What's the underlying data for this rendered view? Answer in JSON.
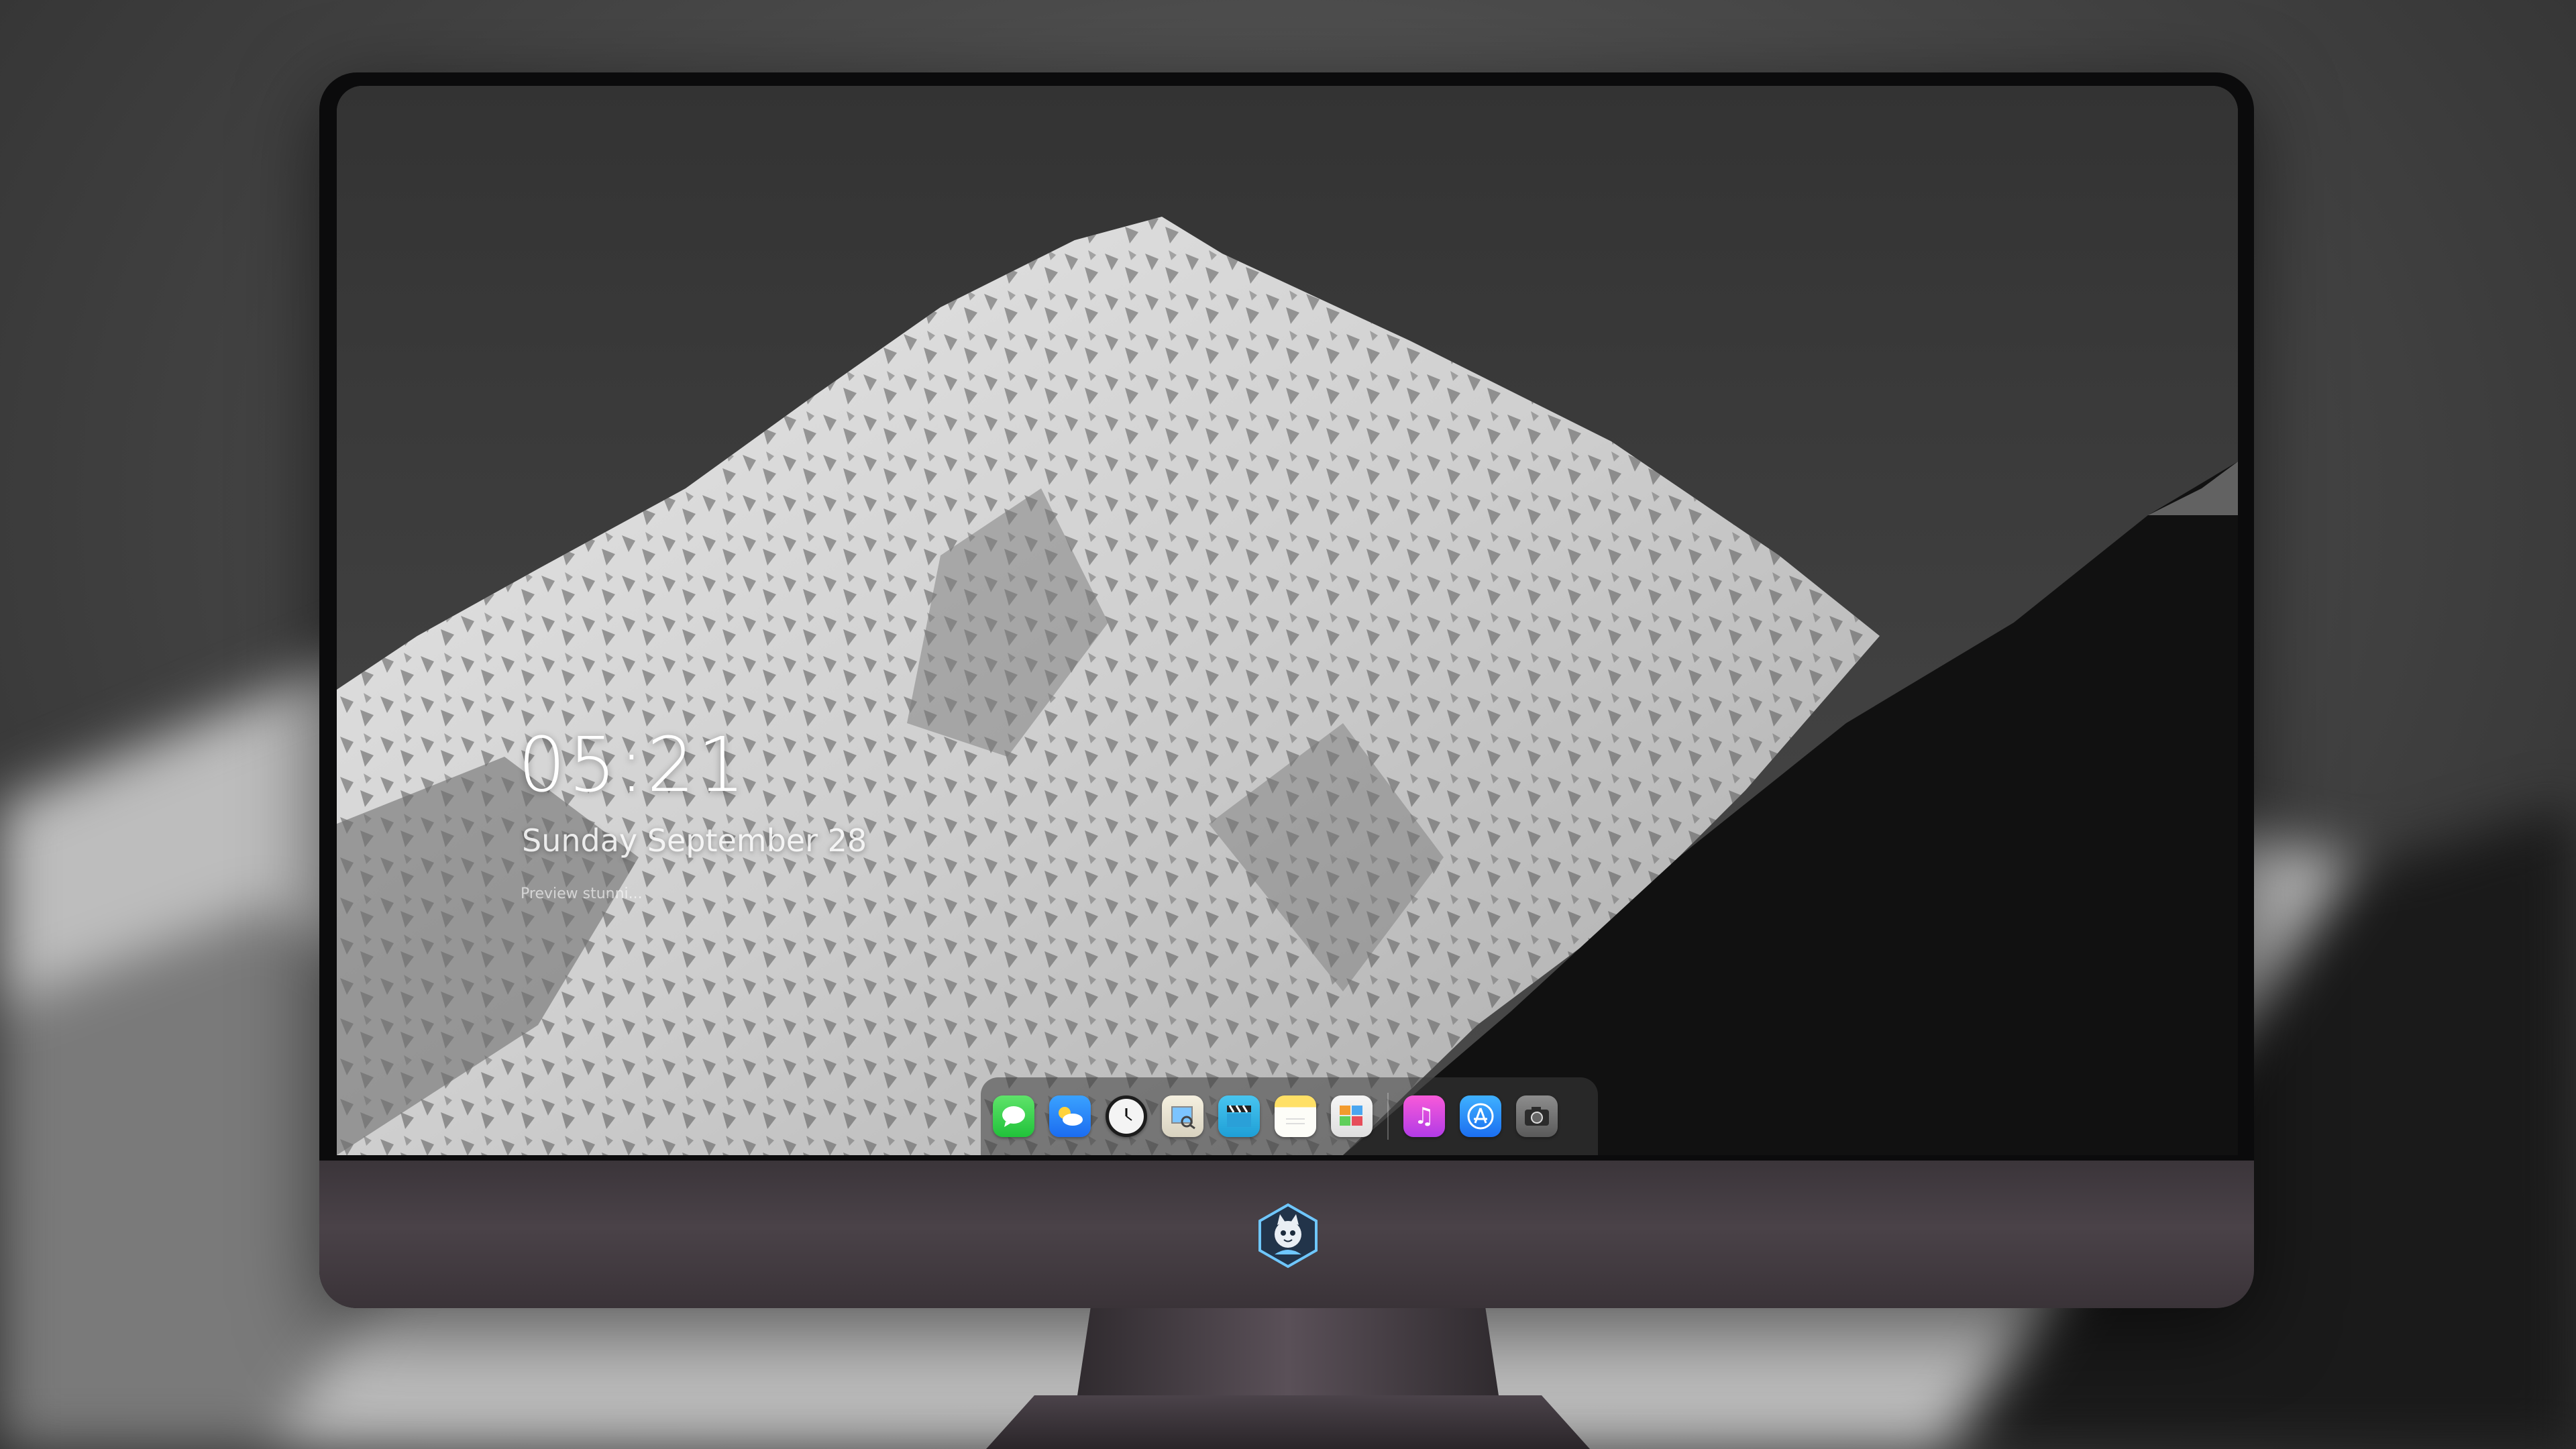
{
  "lockscreen": {
    "time": "05:21",
    "date": "Sunday September 28",
    "caption": "Preview stunni..."
  },
  "dock": {
    "apps": [
      {
        "name": "messages",
        "icon": "messages-icon"
      },
      {
        "name": "weather",
        "icon": "weather-icon"
      },
      {
        "name": "clock",
        "icon": "clock-icon"
      },
      {
        "name": "preview",
        "icon": "preview-icon"
      },
      {
        "name": "clips",
        "icon": "clapperboard-icon"
      },
      {
        "name": "notes",
        "icon": "notes-icon"
      },
      {
        "name": "photos",
        "icon": "photo-booth-icon"
      },
      {
        "name": "music",
        "icon": "music-note-icon"
      },
      {
        "name": "app-store",
        "icon": "app-store-icon"
      },
      {
        "name": "camera",
        "icon": "camera-icon"
      }
    ]
  },
  "colors": {
    "monitor_bezel": "#0b0b0c",
    "monitor_chin": "#4a4248",
    "sky": "#3d3d3d"
  }
}
